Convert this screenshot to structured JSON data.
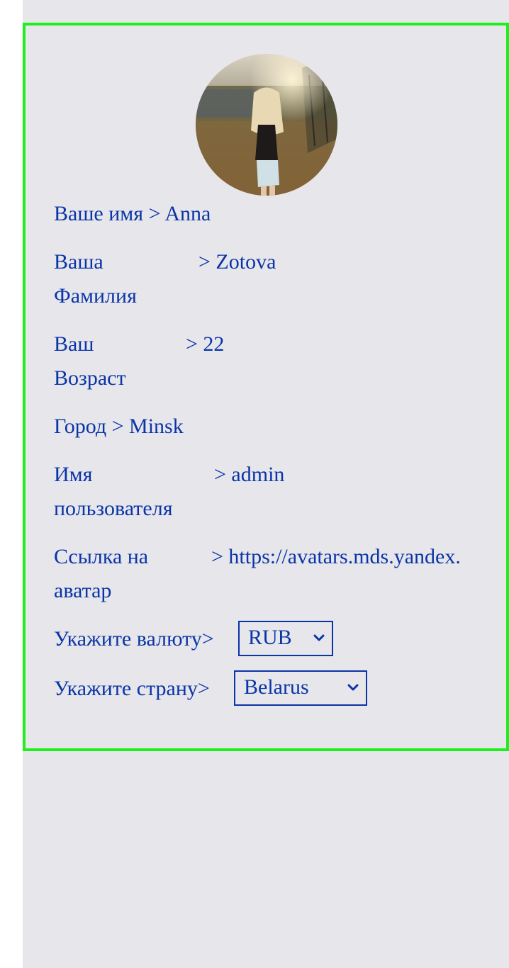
{
  "profile": {
    "name_label": "Ваше имя",
    "name_value": "> Anna",
    "surname_label_1": "Ваша",
    "surname_label_2": "Фамилия",
    "surname_value": "> Zotova",
    "age_label_1": "Ваш",
    "age_label_2": "Возраст",
    "age_value": "> 22",
    "city_label": "Город",
    "city_value": "> Minsk",
    "username_label_1": "Имя",
    "username_label_2": "пользователя",
    "username_value": "> admin",
    "avatar_link_label_1": "Ссылка на",
    "avatar_link_label_2": "аватар",
    "avatar_link_value": "> https://avatars.mds.yandex."
  },
  "currency": {
    "label": "Укажите валюту>",
    "selected": "RUB"
  },
  "country": {
    "label": "Укажите страну>",
    "selected": "Belarus"
  },
  "colors": {
    "text": "#0a35a8",
    "border": "#1ef01e",
    "background": "#e7e6ea"
  },
  "icons": {
    "avatar": "avatar-photo",
    "dropdown": "chevron-down-icon"
  }
}
